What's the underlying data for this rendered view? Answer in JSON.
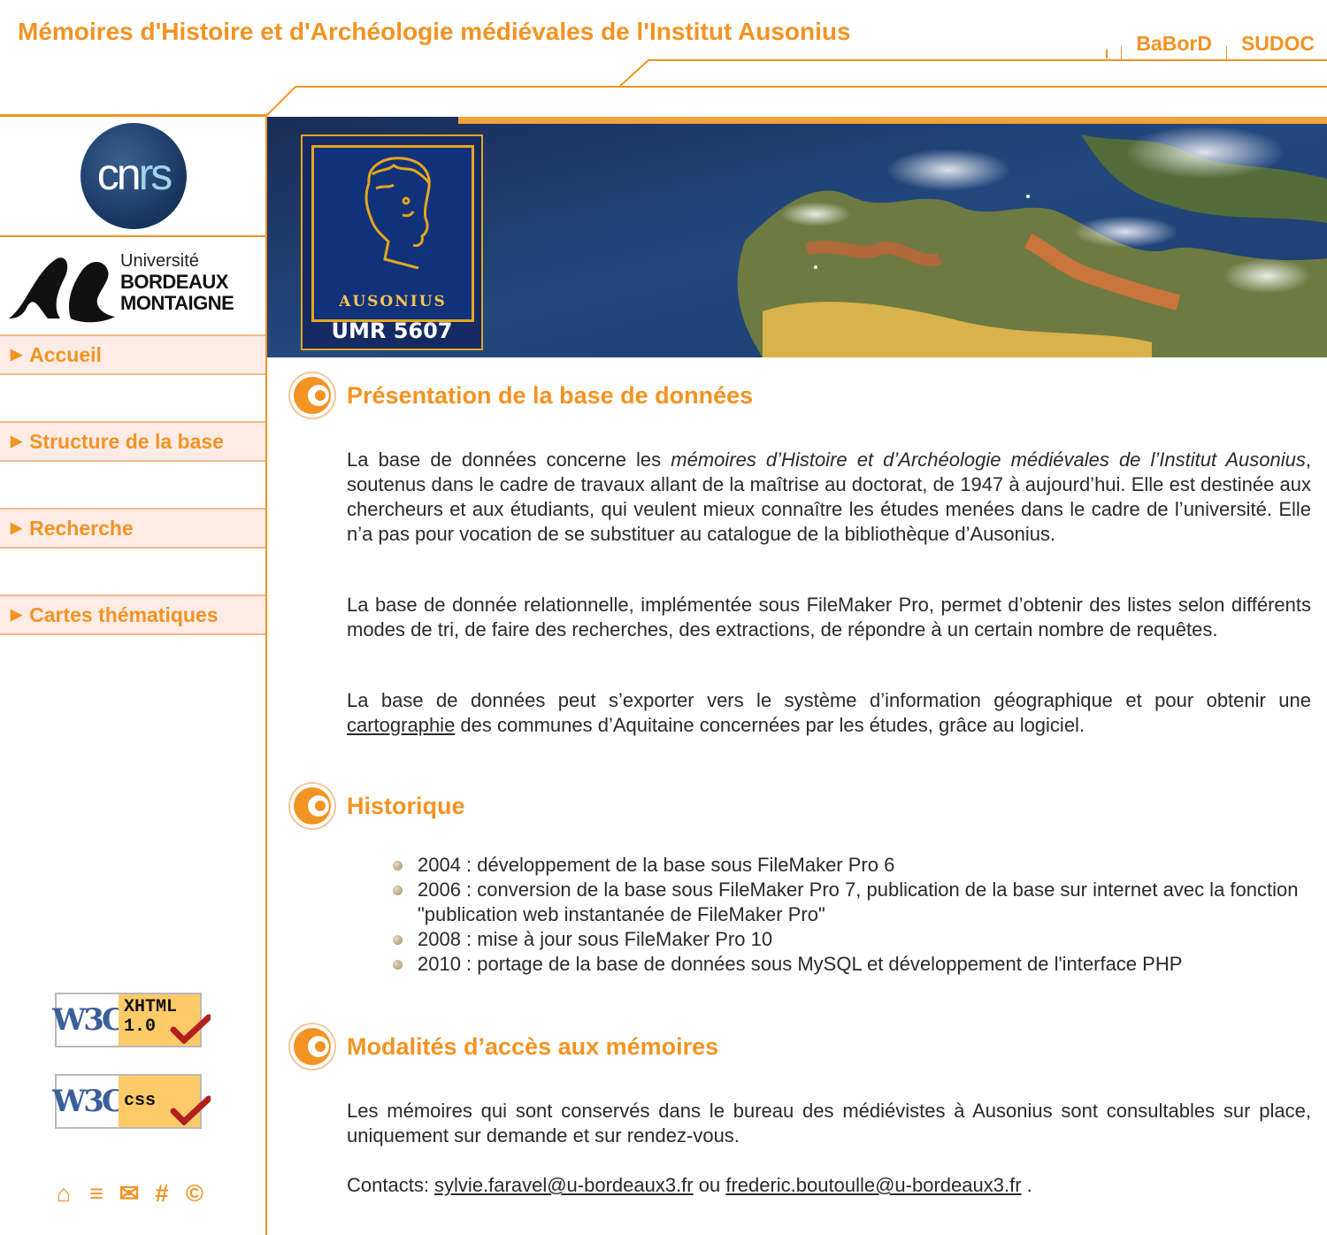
{
  "header": {
    "title": "Mémoires d'Histoire et d'Archéologie médiévales de l'Institut Ausonius",
    "links": [
      "BaBorD",
      "SUDOC"
    ]
  },
  "logos": {
    "cnrs": {
      "text_c": "cn",
      "text_rs": "rs"
    },
    "university": {
      "line1": "Université",
      "line2": "BORDEAUX",
      "line3": "MONTAIGNE"
    }
  },
  "nav": {
    "items": [
      {
        "label": "Accueil"
      },
      {
        "label": "Structure de la base"
      },
      {
        "label": "Recherche"
      },
      {
        "label": "Cartes thématiques"
      }
    ],
    "arrow_glyph": "▶"
  },
  "badges": {
    "xhtml": {
      "w3c": "W3C",
      "line1": "XHTML",
      "line2": "1.0"
    },
    "css": {
      "w3c": "W3C",
      "line1": "css"
    }
  },
  "footer_icons": [
    {
      "name": "home-icon",
      "glyph": "⌂"
    },
    {
      "name": "printer-icon",
      "glyph": "≡"
    },
    {
      "name": "mail-icon",
      "glyph": "✉"
    },
    {
      "name": "hash-icon",
      "glyph": "#"
    },
    {
      "name": "copyright-icon",
      "glyph": "©"
    }
  ],
  "banner": {
    "institution": "AUSONIUS",
    "umr": "UMR 5607"
  },
  "sections": {
    "presentation": {
      "title": "Présentation de la base de données",
      "p1_a": "La base de données concerne les ",
      "p1_em": "mémoires d’Histoire et d’Archéologie médiévales de l’Institut Ausonius",
      "p1_b": ", soutenus dans le cadre de travaux allant de la maîtrise au doctorat, de 1947 à aujourd’hui. Elle est destinée aux chercheurs et aux étudiants, qui veulent mieux connaître les études menées dans le cadre de l’université. Elle n’a pas pour vocation de se substituer au catalogue de la bibliothèque d’Ausonius.",
      "p2": "La base de donnée relationnelle, implémentée sous FileMaker Pro, permet d’obtenir des listes selon différents modes de tri, de faire des recherches, des extractions, de répondre à un certain nombre de requêtes.",
      "p3_a": "La base de données peut s’exporter vers le système d’information géographique et pour obtenir une ",
      "p3_link": "cartographie",
      "p3_b": " des communes d’Aquitaine concernées par les études, grâce au logiciel."
    },
    "historique": {
      "title": "Historique",
      "items": [
        "2004 : développement de la base sous FileMaker Pro 6",
        "2006 : conversion de la base sous FileMaker Pro 7, publication de la base sur internet avec la fonction \"publication web instantanée de FileMaker Pro\"",
        "2008 : mise à jour sous FileMaker Pro 10",
        "2010 : portage de la base de données sous MySQL et développement de l'interface PHP"
      ]
    },
    "acces": {
      "title": "Modalités d’accès aux mémoires",
      "p1": "Les mémoires qui sont conservés dans le bureau des médiévistes à Ausonius sont consultables sur place, uniquement sur demande et sur rendez-vous.",
      "contacts_label": "Contacts: ",
      "email1": "sylvie.faravel@u-bordeaux3.fr",
      "or": " ou ",
      "email2": "frederic.boutoulle@u-bordeaux3.fr",
      "end": " ."
    }
  },
  "colors": {
    "accent": "#f39322",
    "nav_bg": "#fdece6",
    "text": "#2a2a2a"
  }
}
